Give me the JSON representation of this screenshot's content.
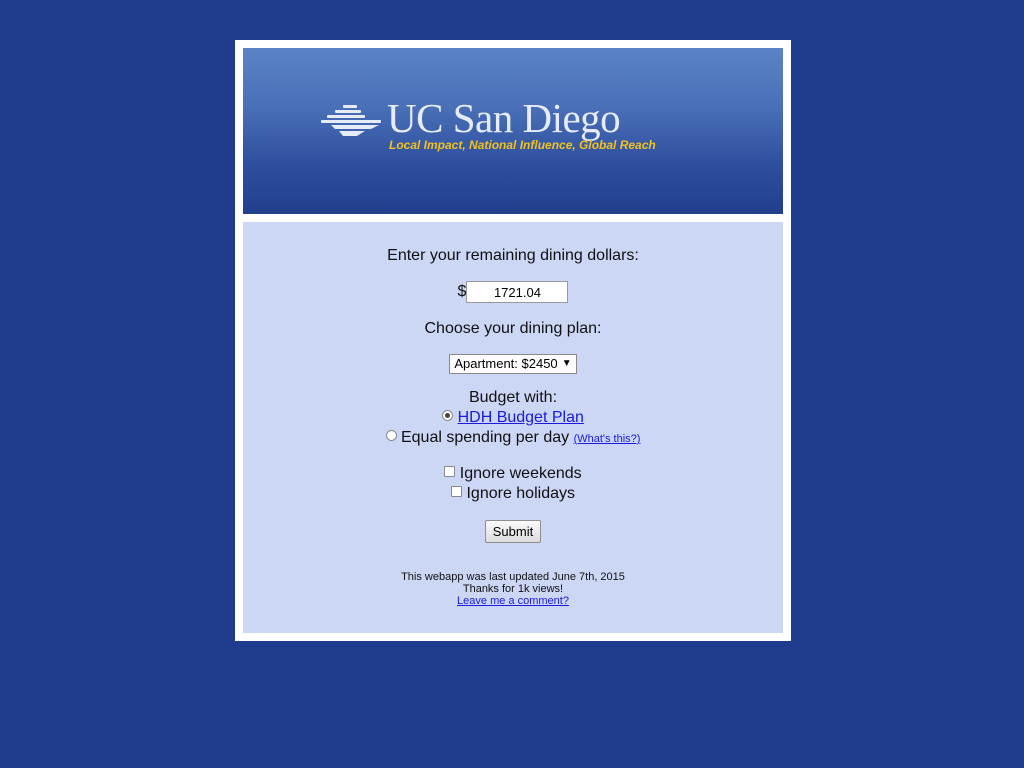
{
  "banner": {
    "logo_text": "UC San Diego",
    "tagline": "Local Impact, National Influence, Global Reach"
  },
  "form": {
    "dollars_prompt": "Enter your remaining dining dollars:",
    "currency_symbol": "$",
    "dollars_value": "1721.04",
    "plan_prompt": "Choose your dining plan:",
    "plan_selected": "Apartment: $2450",
    "budget_prompt": "Budget with:",
    "budget_options": [
      {
        "label": "HDH Budget Plan",
        "checked": true,
        "is_link": true
      },
      {
        "label": "Equal spending per day",
        "checked": false,
        "is_link": false
      }
    ],
    "whats_this_link": "(What's this?)",
    "checkboxes": [
      {
        "label": "Ignore weekends",
        "checked": false
      },
      {
        "label": "Ignore holidays",
        "checked": false
      }
    ],
    "submit_label": "Submit"
  },
  "footer": {
    "updated_text": "This webapp was last updated June 7th, 2015",
    "views_text": "Thanks for 1k views!",
    "comment_link": "Leave me a comment?"
  },
  "colors": {
    "page_background": "#1f3b8c",
    "panel_background": "#ccd6f5",
    "link": "#1a1ae0",
    "tagline": "#f2c21c"
  }
}
